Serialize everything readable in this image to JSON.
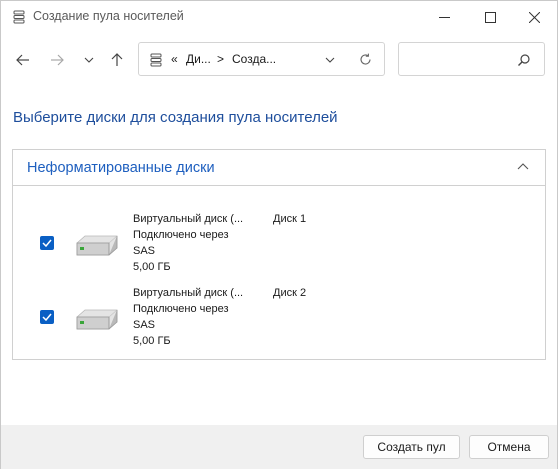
{
  "window": {
    "title": "Создание пула носителей",
    "title_icon": "storage-pool-icon"
  },
  "nav": {
    "back_icon": "arrow-left-icon",
    "forward_icon": "arrow-right-icon",
    "recent_icon": "chevron-down-icon",
    "up_icon": "arrow-up-icon",
    "address_overflow": "«",
    "breadcrumb_1": "Ди...",
    "breadcrumb_2": "Созда...",
    "separator": ">",
    "refresh_icon": "refresh-icon",
    "search_placeholder": ""
  },
  "heading": "Выберите диски для создания пула носителей",
  "group": {
    "title": "Неформатированные диски",
    "disks": [
      {
        "name": "Виртуальный диск (...",
        "number": "Диск 1",
        "connection": "Подключено через",
        "bus": "SAS",
        "size": "5,00 ГБ",
        "checked": true
      },
      {
        "name": "Виртуальный диск (...",
        "number": "Диск 2",
        "connection": "Подключено через",
        "bus": "SAS",
        "size": "5,00 ГБ",
        "checked": true
      }
    ]
  },
  "buttons": {
    "create": "Создать пул",
    "cancel": "Отмена"
  },
  "colors": {
    "accent": "#0a5fc4",
    "heading": "#1e4e9c",
    "footer_bg": "#f0f0f0"
  }
}
